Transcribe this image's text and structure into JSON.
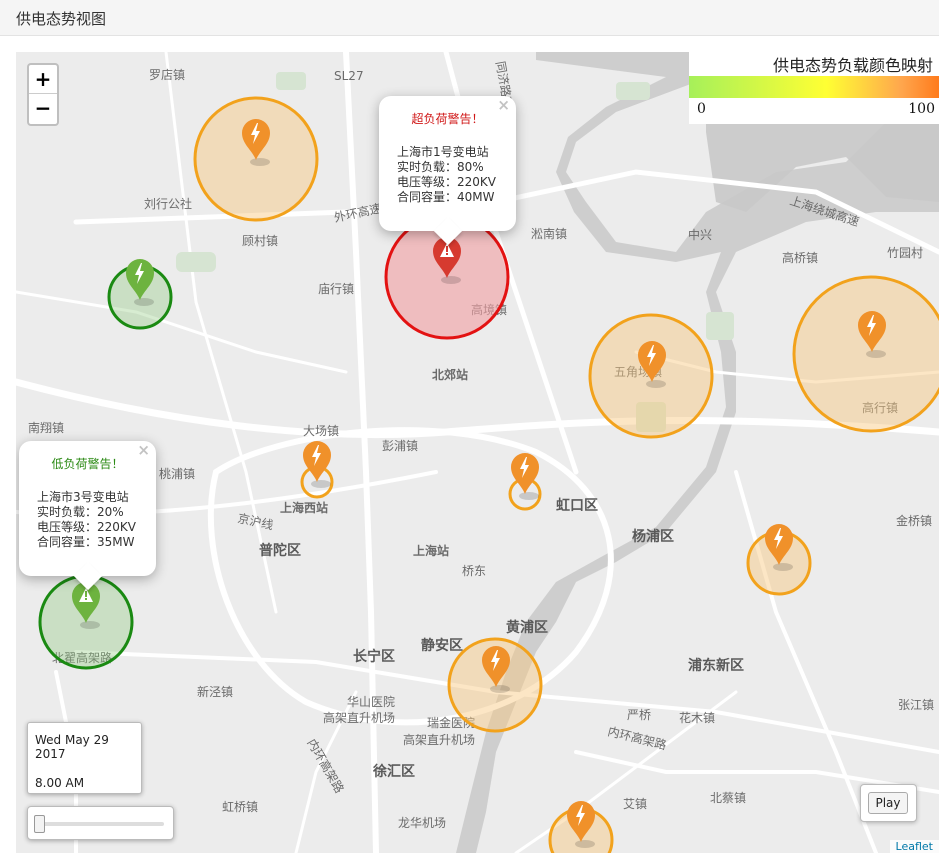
{
  "panel": {
    "title": "供电态势视图"
  },
  "zoom": {
    "in_label": "+",
    "out_label": "−"
  },
  "legend": {
    "title": "供电态势负载颜色映射",
    "min": "0",
    "max": "100"
  },
  "places": [
    {
      "name": "罗店镇"
    },
    {
      "name": "刘行公社"
    },
    {
      "name": "顾村镇"
    },
    {
      "name": "庙行镇"
    },
    {
      "name": "淞南镇"
    },
    {
      "name": "中兴"
    },
    {
      "name": "高桥镇"
    },
    {
      "name": "竹园村"
    },
    {
      "name": "高境镇"
    },
    {
      "name": "北郊站"
    },
    {
      "name": "五角场镇"
    },
    {
      "name": "高行镇"
    },
    {
      "name": "南翔镇"
    },
    {
      "name": "大场镇"
    },
    {
      "name": "彭浦镇"
    },
    {
      "name": "桃浦镇"
    },
    {
      "name": "上海西站"
    },
    {
      "name": "上海站"
    },
    {
      "name": "桥东"
    },
    {
      "name": "金桥镇"
    },
    {
      "name": "新泾镇"
    },
    {
      "name": "华山医院"
    },
    {
      "name": "高架直升机场"
    },
    {
      "name": "瑞金医院"
    },
    {
      "name": "高架直升机场"
    },
    {
      "name": "严桥"
    },
    {
      "name": "花木镇"
    },
    {
      "name": "张江镇"
    },
    {
      "name": "虹桥镇"
    },
    {
      "name": "龙华机场"
    },
    {
      "name": "艾镇"
    },
    {
      "name": "北蔡镇"
    },
    {
      "name": "外环高速"
    },
    {
      "name": "上海绕城高速"
    },
    {
      "name": "京沪线"
    },
    {
      "name": "内环高架路"
    },
    {
      "name": "北翟高架路"
    },
    {
      "name": "内环高架路"
    },
    {
      "name": "SL27"
    },
    {
      "name": "同济路高架"
    }
  ],
  "districts": [
    {
      "name": "虹口区"
    },
    {
      "name": "杨浦区"
    },
    {
      "name": "普陀区"
    },
    {
      "name": "静安区"
    },
    {
      "name": "黄浦区"
    },
    {
      "name": "长宁区"
    },
    {
      "name": "浦东新区"
    },
    {
      "name": "徐汇区"
    }
  ],
  "stations": [
    {
      "name": "上海市1号变电站",
      "status": "overload",
      "load": 80
    },
    {
      "name": "上海市3号变电站",
      "status": "underload",
      "load": 20
    }
  ],
  "colors": {
    "overload": "#e01b1b",
    "underload": "#2e8b1a",
    "normal": "#f0a020",
    "marker_orange": "#f0912a",
    "marker_green": "#6db33f",
    "marker_red": "#d63a2f"
  },
  "popup_overload": {
    "title": "超负荷警告！",
    "station": "上海市1号变电站",
    "load": "实时负载：80%",
    "voltage": "电压等级：220KV",
    "capacity": "合同容量：40MW",
    "close": "×"
  },
  "popup_underload": {
    "title": "低负荷警告！",
    "station": "上海市3号变电站",
    "load": "实时负载：20%",
    "voltage": "电压等级：220KV",
    "capacity": "合同容量：35MW",
    "close": "×"
  },
  "time": {
    "date": "Wed May 29 2017",
    "time": "8.00 AM"
  },
  "slider": {
    "position": 0
  },
  "play_button": "Play",
  "attribution": "Leaflet"
}
